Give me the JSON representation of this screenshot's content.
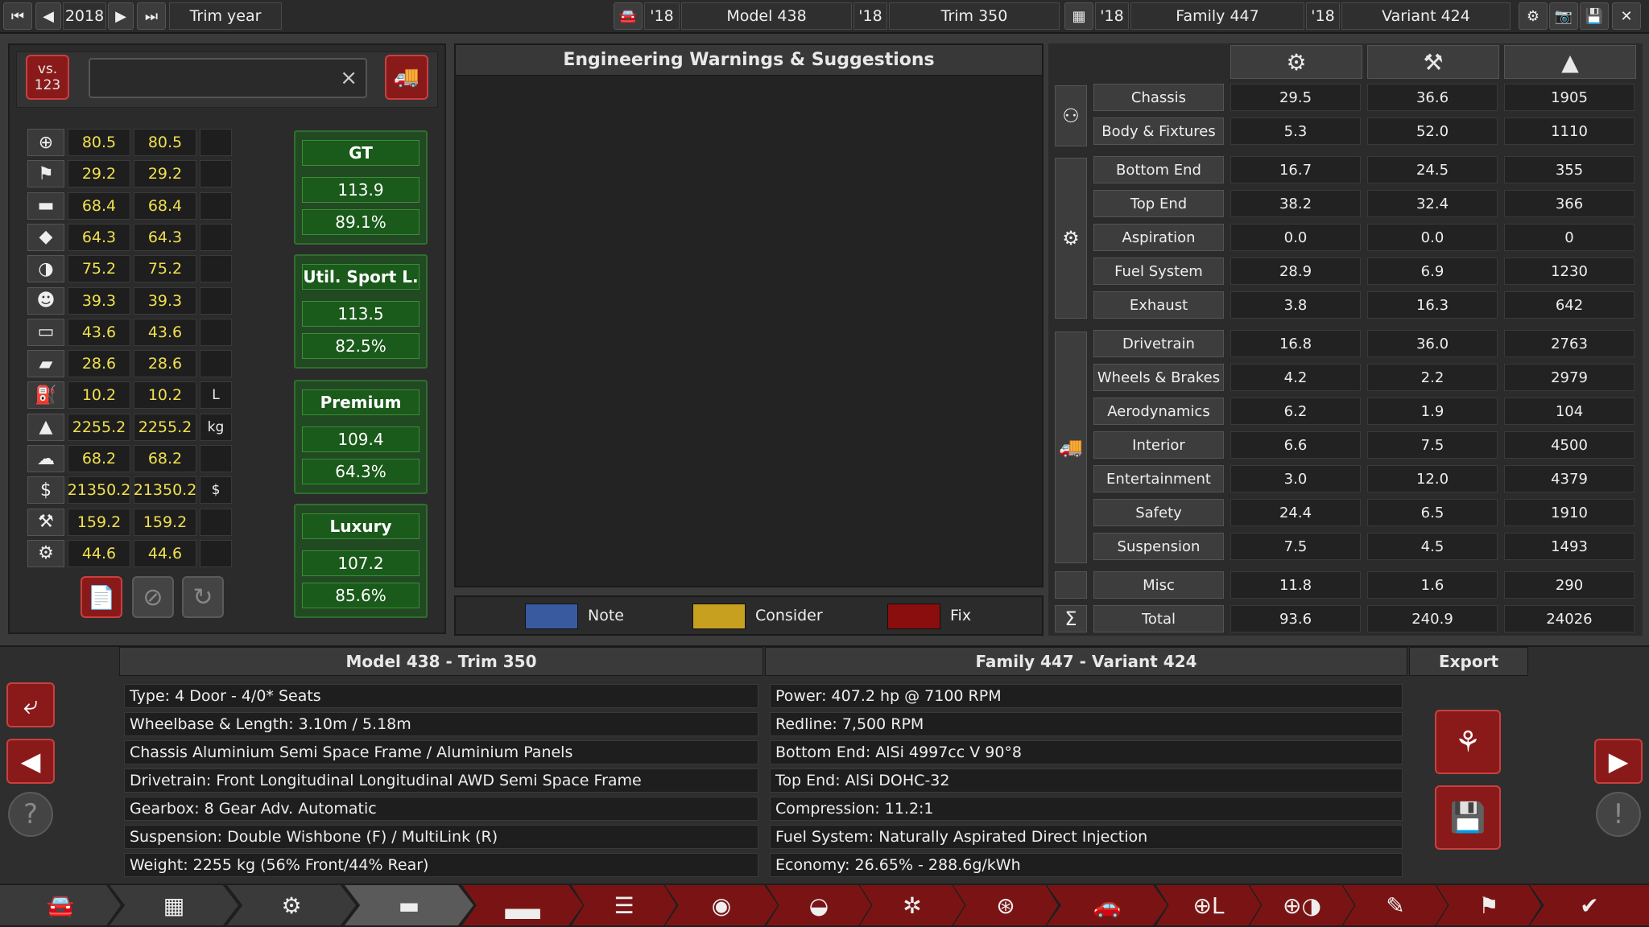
{
  "topbar": {
    "year": "2018",
    "trim_year_label": "Trim year",
    "model_year": "'18",
    "model": "Model 438",
    "trim_year": "'18",
    "trim": "Trim 350",
    "family_year": "'18",
    "family": "Family 447",
    "variant_year": "'18",
    "variant": "Variant 424"
  },
  "compare": {
    "vs_label": "vs.",
    "vs_number": "123",
    "search_value": "",
    "clear": "×"
  },
  "stats": [
    {
      "icon": "steering-wheel-icon",
      "glyph": "⊕",
      "a": "80.5",
      "b": "80.5",
      "unit": ""
    },
    {
      "icon": "race-flag-icon",
      "glyph": "⚑",
      "a": "29.2",
      "b": "29.2",
      "unit": ""
    },
    {
      "icon": "seat-icon",
      "glyph": "▬",
      "a": "68.4",
      "b": "68.4",
      "unit": ""
    },
    {
      "icon": "diamond-icon",
      "glyph": "◆",
      "a": "64.3",
      "b": "64.3",
      "unit": ""
    },
    {
      "icon": "safety-wheel-icon",
      "glyph": "◑",
      "a": "75.2",
      "b": "75.2",
      "unit": ""
    },
    {
      "icon": "people-icon",
      "glyph": "☻",
      "a": "39.3",
      "b": "39.3",
      "unit": ""
    },
    {
      "icon": "cargo-car-icon",
      "glyph": "▭",
      "a": "43.6",
      "b": "43.6",
      "unit": ""
    },
    {
      "icon": "offroad-car-icon",
      "glyph": "▰",
      "a": "28.6",
      "b": "28.6",
      "unit": ""
    },
    {
      "icon": "fuel-icon",
      "glyph": "⛽",
      "a": "10.2",
      "b": "10.2",
      "unit": "L"
    },
    {
      "icon": "weight-icon",
      "glyph": "▲",
      "a": "2255.2",
      "b": "2255.2",
      "unit": "kg"
    },
    {
      "icon": "environment-icon",
      "glyph": "☁",
      "a": "68.2",
      "b": "68.2",
      "unit": ""
    },
    {
      "icon": "cost-icon",
      "glyph": "$",
      "a": "21350.2",
      "b": "21350.2",
      "unit": "$"
    },
    {
      "icon": "anvil-icon",
      "glyph": "⚒",
      "a": "159.2",
      "b": "159.2",
      "unit": ""
    },
    {
      "icon": "engineering-gear-icon",
      "glyph": "⚙",
      "a": "44.6",
      "b": "44.6",
      "unit": ""
    }
  ],
  "markets": [
    {
      "name": "GT",
      "score": "113.9",
      "pct": "89.1%"
    },
    {
      "name": "Util. Sport L.",
      "score": "113.5",
      "pct": "82.5%"
    },
    {
      "name": "Premium",
      "score": "109.4",
      "pct": "64.3%"
    },
    {
      "name": "Luxury",
      "score": "107.2",
      "pct": "85.6%"
    }
  ],
  "warnings": {
    "title": "Engineering Warnings & Suggestions",
    "legend": [
      {
        "label": "Note",
        "color": "#3a5aa0"
      },
      {
        "label": "Consider",
        "color": "#c8a020"
      },
      {
        "label": "Fix",
        "color": "#8a0e0e"
      }
    ]
  },
  "components": [
    {
      "name": "Chassis",
      "v1": "29.5",
      "v2": "36.6",
      "v3": "1905"
    },
    {
      "name": "Body & Fixtures",
      "v1": "5.3",
      "v2": "52.0",
      "v3": "1110"
    },
    {
      "name": "Bottom End",
      "v1": "16.7",
      "v2": "24.5",
      "v3": "355"
    },
    {
      "name": "Top End",
      "v1": "38.2",
      "v2": "32.4",
      "v3": "366"
    },
    {
      "name": "Aspiration",
      "v1": "0.0",
      "v2": "0.0",
      "v3": "0"
    },
    {
      "name": "Fuel System",
      "v1": "28.9",
      "v2": "6.9",
      "v3": "1230"
    },
    {
      "name": "Exhaust",
      "v1": "3.8",
      "v2": "16.3",
      "v3": "642"
    },
    {
      "name": "Drivetrain",
      "v1": "16.8",
      "v2": "36.0",
      "v3": "2763"
    },
    {
      "name": "Wheels & Brakes",
      "v1": "4.2",
      "v2": "2.2",
      "v3": "2979"
    },
    {
      "name": "Aerodynamics",
      "v1": "6.2",
      "v2": "1.9",
      "v3": "104"
    },
    {
      "name": "Interior",
      "v1": "6.6",
      "v2": "7.5",
      "v3": "4500"
    },
    {
      "name": "Entertainment",
      "v1": "3.0",
      "v2": "12.0",
      "v3": "4379"
    },
    {
      "name": "Safety",
      "v1": "24.4",
      "v2": "6.5",
      "v3": "1910"
    },
    {
      "name": "Suspension",
      "v1": "7.5",
      "v2": "4.5",
      "v3": "1493"
    },
    {
      "name": "Misc",
      "v1": "11.8",
      "v2": "1.6",
      "v3": "290"
    },
    {
      "name": "Total",
      "v1": "93.6",
      "v2": "240.9",
      "v3": "24026"
    }
  ],
  "summary": {
    "left_title": "Model 438 - Trim 350",
    "right_title": "Family 447 - Variant 424",
    "export_title": "Export",
    "left": [
      "Type: 4 Door - 4/0* Seats",
      "Wheelbase & Length: 3.10m / 5.18m",
      "Chassis Aluminium Semi Space Frame / Aluminium Panels",
      "Drivetrain: Front Longitudinal Longitudinal AWD Semi Space Frame",
      "Gearbox: 8 Gear Adv. Automatic",
      "Suspension: Double Wishbone (F) / MultiLink (R)",
      "Weight: 2255 kg (56% Front/44% Rear)"
    ],
    "right": [
      "Power: 407.2 hp @ 7100 RPM",
      "Redline:  7,500 RPM",
      "Bottom End: AlSi 4997cc V 90°8",
      "Top End: AlSi DOHC-32",
      "Compression: 11.2:1",
      "Fuel System: Naturally Aspirated Direct Injection",
      "Economy: 26.65% - 288.6g/kWh"
    ]
  },
  "colors": {
    "accent_red": "#8a1a1a",
    "market_green": "#1a5a1a",
    "value_yellow": "#f0e050"
  }
}
